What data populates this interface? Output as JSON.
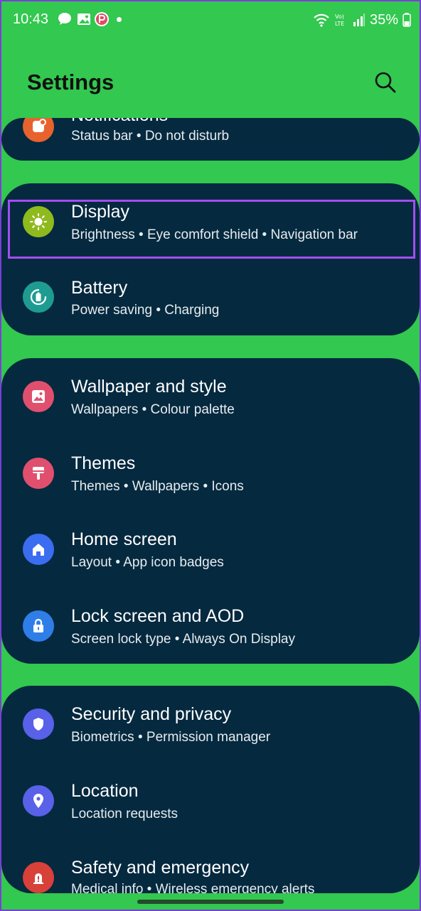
{
  "status_bar": {
    "time": "10:43",
    "battery": "35%",
    "icons": [
      "chat-bubble-icon",
      "gallery-icon",
      "app-p-icon",
      "wifi-icon",
      "volte-icon",
      "signal-icon",
      "battery-icon"
    ]
  },
  "header": {
    "title": "Settings",
    "search_icon": "search-icon"
  },
  "colors": {
    "background": "#33c84f",
    "card": "#05293f",
    "highlight": "#a34ef0"
  },
  "items": {
    "notifications": {
      "title": "Notifications",
      "sub": "Status bar  •  Do not disturb",
      "icon": "notifications-icon",
      "color": "#e8622e"
    },
    "display": {
      "title": "Display",
      "sub": "Brightness  •  Eye comfort shield  •  Navigation bar",
      "icon": "sun-icon",
      "color": "#8fba1e"
    },
    "battery": {
      "title": "Battery",
      "sub": "Power saving  •  Charging",
      "icon": "battery-care-icon",
      "color": "#1f9c92"
    },
    "wallpaper": {
      "title": "Wallpaper and style",
      "sub": "Wallpapers  •  Colour palette",
      "icon": "image-icon",
      "color": "#e0506e"
    },
    "themes": {
      "title": "Themes",
      "sub": "Themes  •  Wallpapers  •  Icons",
      "icon": "brush-icon",
      "color": "#e0506e"
    },
    "home_screen": {
      "title": "Home screen",
      "sub": "Layout  •  App icon badges",
      "icon": "home-icon",
      "color": "#3a6df0"
    },
    "lock_screen": {
      "title": "Lock screen and AOD",
      "sub": "Screen lock type  •  Always On Display",
      "icon": "lock-icon",
      "color": "#2f7ee8"
    },
    "security": {
      "title": "Security and privacy",
      "sub": "Biometrics  •  Permission manager",
      "icon": "shield-icon",
      "color": "#5861e8"
    },
    "location": {
      "title": "Location",
      "sub": "Location requests",
      "icon": "location-pin-icon",
      "color": "#5861e8"
    },
    "safety": {
      "title": "Safety and emergency",
      "sub": "Medical info  •  Wireless emergency alerts",
      "icon": "emergency-icon",
      "color": "#d8403a"
    }
  }
}
